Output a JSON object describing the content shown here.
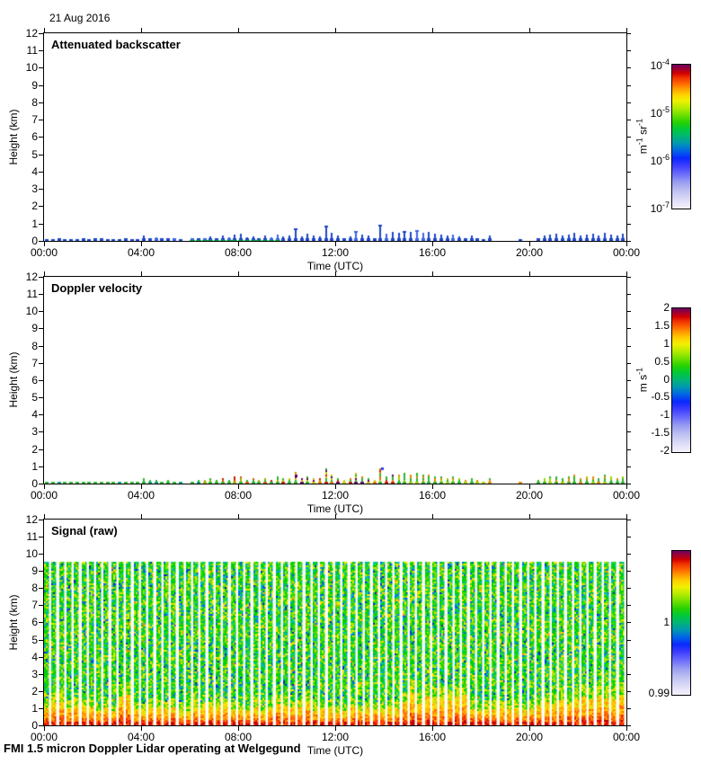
{
  "header": {
    "date": "21 Aug 2016"
  },
  "footer": {
    "text": "FMI 1.5 micron Doppler Lidar operating at Welgegund"
  },
  "colormap": {
    "description": "lidar quicklook colormap, bottom(min)=pale lavender to top(max)=dark purple",
    "stops": [
      [
        0,
        "#f4f2fc"
      ],
      [
        5,
        "#e2e0f8"
      ],
      [
        12,
        "#c0c2f2"
      ],
      [
        18,
        "#9aa0f0"
      ],
      [
        24,
        "#6a6cfa"
      ],
      [
        30,
        "#3c3cff"
      ],
      [
        35,
        "#0a28ff"
      ],
      [
        40,
        "#0064e6"
      ],
      [
        45,
        "#0096b4"
      ],
      [
        50,
        "#00b478"
      ],
      [
        55,
        "#00c83c"
      ],
      [
        60,
        "#28d200"
      ],
      [
        65,
        "#6ee000"
      ],
      [
        70,
        "#b4ec00"
      ],
      [
        75,
        "#f0f000"
      ],
      [
        79,
        "#ffd200"
      ],
      [
        83,
        "#ffa000"
      ],
      [
        87,
        "#ff6400"
      ],
      [
        91,
        "#f03200"
      ],
      [
        94,
        "#d20000"
      ],
      [
        97,
        "#a00032"
      ],
      [
        100,
        "#6e0064"
      ]
    ]
  },
  "axes": {
    "xlabel": "Time (UTC)",
    "ylabel": "Height (km)",
    "xlim_hours": [
      0,
      24
    ],
    "ylim_km": [
      0,
      12
    ],
    "xticks": [
      {
        "h": 0,
        "label": "00:00"
      },
      {
        "h": 4,
        "label": "04:00"
      },
      {
        "h": 8,
        "label": "08:00"
      },
      {
        "h": 12,
        "label": "12:00"
      },
      {
        "h": 16,
        "label": "16:00"
      },
      {
        "h": 20,
        "label": "20:00"
      },
      {
        "h": 24,
        "label": "00:00"
      }
    ],
    "yticks": [
      0,
      1,
      2,
      3,
      4,
      5,
      6,
      7,
      8,
      9,
      10,
      11,
      12
    ]
  },
  "chart_data": [
    {
      "type": "heatmap",
      "title": "Attenuated backscatter",
      "colorbar": {
        "scale": "log",
        "ticks": [
          {
            "f": 0.0,
            "t": "10",
            "sup": "-4"
          },
          {
            "f": 0.333,
            "t": "10",
            "sup": "-5"
          },
          {
            "f": 0.667,
            "t": "10",
            "sup": "-6"
          },
          {
            "f": 1.0,
            "t": "10",
            "sup": "-7"
          }
        ],
        "unit_parts": [
          [
            "m",
            "-1"
          ],
          [
            " sr",
            "-1"
          ]
        ]
      },
      "series": {
        "kind": "near-surface aerosol layer with intermittent spikes",
        "t_step_h": 0.25,
        "heights_km": [
          0.12,
          0.1,
          0.13,
          0.1,
          0.12,
          0.1,
          0.14,
          0.1,
          0.13,
          0.14,
          0.1,
          0.12,
          0.1,
          0.13,
          0.1,
          0.12,
          0.32,
          0.18,
          0.22,
          0.15,
          0.2,
          0.14,
          0.1,
          0,
          0.14,
          0.18,
          0.16,
          0.26,
          0.2,
          0.3,
          0.22,
          0.36,
          0.42,
          0.22,
          0.26,
          0.18,
          0.3,
          0.22,
          0.36,
          0.26,
          0.3,
          0.72,
          0.28,
          0.4,
          0.3,
          0.26,
          0.9,
          0.46,
          0.3,
          0.2,
          0.26,
          0.56,
          0.36,
          0.3,
          0.2,
          0.95,
          0.42,
          0.5,
          0.46,
          0.56,
          0.5,
          0.62,
          0.46,
          0.52,
          0.4,
          0.36,
          0.3,
          0.36,
          0.26,
          0.2,
          0.3,
          0.16,
          0.1,
          0.32,
          0,
          0,
          0,
          0,
          0.1,
          0,
          0,
          0.16,
          0.3,
          0.36,
          0.42,
          0.3,
          0.36,
          0.46,
          0.3,
          0.36,
          0.42,
          0.3,
          0.46,
          0.36,
          0.3,
          0.42
        ],
        "colors": {
          "base": "#1e46c8",
          "alt": "#3c64e6",
          "surface_green": {
            "t": [
              6,
              9.5
            ],
            "color": "#00a53c"
          }
        }
      }
    },
    {
      "type": "heatmap",
      "title": "Doppler velocity",
      "colorbar": {
        "scale": "linear",
        "ticks": [
          {
            "f": 0.0,
            "t": "2",
            "sup": ""
          },
          {
            "f": 0.125,
            "t": "1.5",
            "sup": ""
          },
          {
            "f": 0.25,
            "t": "1",
            "sup": ""
          },
          {
            "f": 0.375,
            "t": "0.5",
            "sup": ""
          },
          {
            "f": 0.5,
            "t": "0",
            "sup": ""
          },
          {
            "f": 0.625,
            "t": "-0.5",
            "sup": ""
          },
          {
            "f": 0.75,
            "t": "-1",
            "sup": ""
          },
          {
            "f": 0.875,
            "t": "-1.5",
            "sup": ""
          },
          {
            "f": 1.0,
            "t": "-2",
            "sup": ""
          }
        ],
        "unit_parts": [
          [
            "m",
            ""
          ],
          [
            " s",
            "-1"
          ]
        ]
      },
      "series": {
        "kind": "same spike locations as backscatter, velocity-coloured",
        "t_step_h": 0.25,
        "heights_km": [
          0.12,
          0.1,
          0.13,
          0.1,
          0.12,
          0.1,
          0.14,
          0.1,
          0.13,
          0.14,
          0.1,
          0.12,
          0.1,
          0.13,
          0.1,
          0.12,
          0.32,
          0.18,
          0.22,
          0.15,
          0.2,
          0.14,
          0.1,
          0,
          0.14,
          0.18,
          0.16,
          0.26,
          0.2,
          0.3,
          0.22,
          0.36,
          0.42,
          0.22,
          0.26,
          0.18,
          0.3,
          0.22,
          0.36,
          0.26,
          0.3,
          0.72,
          0.28,
          0.4,
          0.3,
          0.26,
          0.9,
          0.46,
          0.3,
          0.2,
          0.26,
          0.56,
          0.36,
          0.3,
          0.2,
          0.95,
          0.42,
          0.5,
          0.46,
          0.56,
          0.5,
          0.62,
          0.46,
          0.52,
          0.4,
          0.36,
          0.3,
          0.36,
          0.26,
          0.2,
          0.3,
          0.16,
          0.1,
          0.32,
          0,
          0,
          0,
          0,
          0.1,
          0,
          0,
          0.16,
          0.3,
          0.36,
          0.42,
          0.3,
          0.36,
          0.46,
          0.3,
          0.36,
          0.42,
          0.3,
          0.46,
          0.36,
          0.3,
          0.42
        ],
        "palette_segments": [
          {
            "t": [
              0,
              6.5
            ],
            "colors": [
              "#2db42d",
              "#2db42d",
              "#2db42d",
              "#00a078"
            ]
          },
          {
            "t": [
              6.5,
              10
            ],
            "colors": [
              "#2db42d",
              "#d25a00",
              "#c82000",
              "#a0b400",
              "#2db42d"
            ]
          },
          {
            "t": [
              10,
              14.5
            ],
            "colors": [
              "#c82000",
              "#e07800",
              "#2db42d",
              "#d2c800",
              "#6a006a",
              "#2db42d"
            ]
          },
          {
            "t": [
              14.5,
              24
            ],
            "colors": [
              "#2db42d",
              "#2db42d",
              "#2db42d",
              "#a0d200",
              "#e08c00"
            ]
          }
        ],
        "extra_dots": [
          {
            "t": 10.35,
            "km": 0.52,
            "color": "#5a0064"
          },
          {
            "t": 13.9,
            "km": 0.95,
            "color": "#2846ff"
          }
        ]
      }
    },
    {
      "type": "heatmap",
      "title": "Signal (raw)",
      "colorbar": {
        "scale": "linear",
        "ticks": [
          {
            "f": 0.5,
            "t": "1",
            "sup": ""
          },
          {
            "f": 1.0,
            "t": "0.99",
            "sup": ""
          }
        ],
        "unit_parts": []
      },
      "texture": {
        "kind": "columned noise speckle, profiles separated by white gaps",
        "top_km": 9.6,
        "col_count": 78,
        "speckle": [
          [
            "#00d200",
            30
          ],
          [
            "#2ee000",
            12
          ],
          [
            "#62d800",
            10
          ],
          [
            "#9be400",
            12
          ],
          [
            "#e8e800",
            9
          ],
          [
            "#ffd700",
            3
          ],
          [
            "#00c89b",
            9
          ],
          [
            "#00aac8",
            6
          ],
          [
            "#0064e6",
            5
          ],
          [
            "#0028c8",
            2
          ],
          [
            "#ff8c00",
            1
          ],
          [
            "#00b464",
            6
          ]
        ],
        "bands": [
          {
            "max_km": 0.12,
            "colors": [
              "#d40000",
              "#ff3200",
              "#b40000",
              "#ff5a00"
            ]
          },
          {
            "max_km": 0.3,
            "colors": [
              "#ff4600",
              "#ff7800",
              "#e62800",
              "#ffa000"
            ]
          },
          {
            "max_km": 0.55,
            "colors": [
              "#ff8c00",
              "#ffb400",
              "#ff6400",
              "#ffd200"
            ]
          },
          {
            "max_km": 0.85,
            "colors": [
              "#ffc800",
              "#ffe000",
              "#ff9e00",
              "#d8e000"
            ]
          },
          {
            "max_km": 1.25,
            "colors": [
              "#d2e600",
              "#a0dc00",
              "#ffe000",
              "#50d200",
              "#00d200"
            ]
          }
        ],
        "deep_red_times": [
          [
            0,
            1.5,
            1.35
          ],
          [
            2.8,
            3.6,
            1.7
          ],
          [
            9.5,
            10.8,
            1.3
          ],
          [
            14.5,
            17.5,
            1.7
          ],
          [
            20.5,
            23.9,
            1.6
          ]
        ]
      }
    }
  ]
}
